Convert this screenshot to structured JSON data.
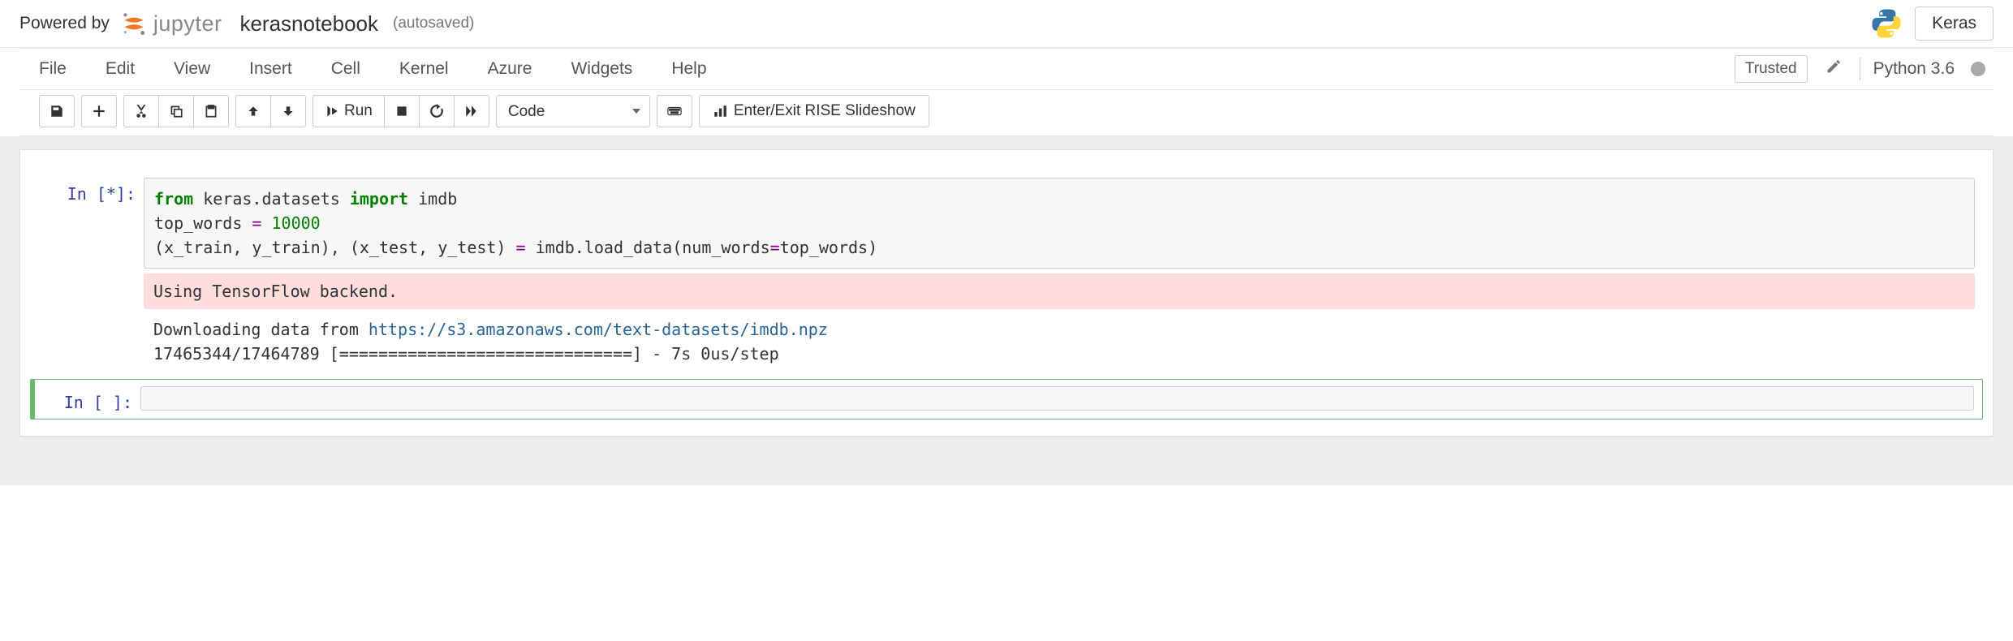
{
  "header": {
    "powered_by": "Powered by",
    "jupyter_word": "jupyter",
    "notebook_name": "kerasnotebook",
    "autosave": "(autosaved)",
    "keras_btn": "Keras"
  },
  "menu": {
    "items": [
      "File",
      "Edit",
      "View",
      "Insert",
      "Cell",
      "Kernel",
      "Azure",
      "Widgets",
      "Help"
    ],
    "trusted": "Trusted",
    "kernel": "Python 3.6"
  },
  "toolbar": {
    "run_label": "Run",
    "cell_type": "Code",
    "rise_label": "Enter/Exit RISE Slideshow"
  },
  "cells": [
    {
      "prompt": "In [*]:",
      "code_tokens": [
        {
          "t": "from",
          "c": "k-green"
        },
        {
          "t": " keras.datasets "
        },
        {
          "t": "import",
          "c": "k-green"
        },
        {
          "t": " imdb\n"
        },
        {
          "t": "top_words "
        },
        {
          "t": "=",
          "c": "k-purple"
        },
        {
          "t": " "
        },
        {
          "t": "10000",
          "c": "k-num"
        },
        {
          "t": "\n"
        },
        {
          "t": "(x_train, y_train), (x_test, y_test) "
        },
        {
          "t": "=",
          "c": "k-purple"
        },
        {
          "t": " imdb"
        },
        {
          "t": "."
        },
        {
          "t": "load_data"
        },
        {
          "t": "(",
          "c": "k-paren"
        },
        {
          "t": "num_words"
        },
        {
          "t": "=",
          "c": "k-purple"
        },
        {
          "t": "top_words"
        },
        {
          "t": ")",
          "c": "k-paren"
        }
      ],
      "stderr": "Using TensorFlow backend.",
      "stdout_pre": "Downloading data from ",
      "stdout_link": "https://s3.amazonaws.com/text-datasets/imdb.npz",
      "stdout_post": "17465344/17464789 [==============================] - 7s 0us/step"
    },
    {
      "prompt": "In [ ]:",
      "code": ""
    }
  ]
}
